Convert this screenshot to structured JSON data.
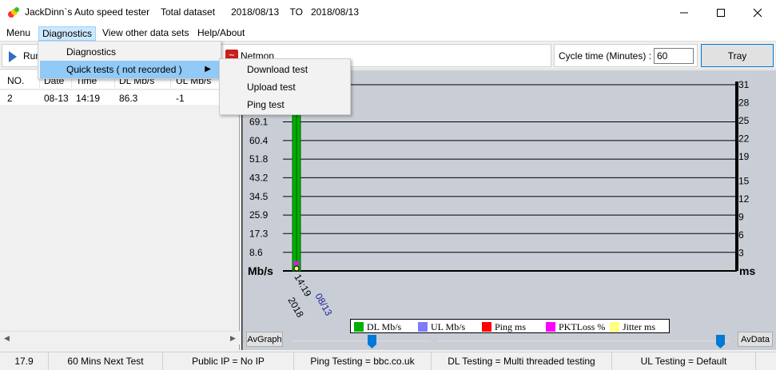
{
  "window": {
    "title": "JackDinn`s Auto speed tester",
    "dataset_label": "Total dataset",
    "date_from": "2018/08/13",
    "to_label": "TO",
    "date_to": "2018/08/13"
  },
  "menubar": {
    "items": [
      {
        "label": "Menu"
      },
      {
        "label": "Diagnostics"
      },
      {
        "label": "View other data sets"
      },
      {
        "label": "Help/About"
      }
    ]
  },
  "diagnostics_menu": {
    "items": [
      {
        "label": "Diagnostics"
      },
      {
        "label": "Quick tests ( not recorded )"
      }
    ]
  },
  "quick_tests_menu": {
    "items": [
      {
        "label": "Download test"
      },
      {
        "label": "Upload test"
      },
      {
        "label": "Ping test"
      }
    ]
  },
  "toolbar": {
    "run_label": "Run",
    "netmon_label": "Netmon",
    "cycle_label": "Cycle time (Minutes) :",
    "cycle_value": "60",
    "tray_label": "Tray"
  },
  "results_table": {
    "columns": [
      "NO.",
      "Date",
      "Time",
      "DL Mb/s",
      "UL Mb/s"
    ],
    "rows": [
      {
        "no": "2",
        "date": "08-13",
        "time": "14:19",
        "dl": "86.3",
        "ul": "-1"
      }
    ]
  },
  "chart_data": {
    "type": "bar",
    "left_axis_unit": "Mb/s",
    "right_axis_unit": "ms",
    "left_ticks": [
      "69.1",
      "60.4",
      "51.8",
      "43.2",
      "34.5",
      "25.9",
      "17.3",
      "8.6"
    ],
    "right_ticks": [
      "31",
      "28",
      "25",
      "22",
      "19",
      "15",
      "12",
      "9",
      "6",
      "3"
    ],
    "left_ylim": [
      0,
      86.3
    ],
    "right_ylim": [
      0,
      31
    ],
    "categories": [
      {
        "time": "14:19",
        "date": "08/13",
        "year": "2018"
      }
    ],
    "series": [
      {
        "name": "DL Mb/s",
        "color": "#00b000",
        "values": [
          86.3
        ]
      },
      {
        "name": "UL Mb/s",
        "color": "#7b7bff",
        "values": [
          -1
        ]
      },
      {
        "name": "Ping ms",
        "color": "#ff0000",
        "values": [
          null
        ]
      },
      {
        "name": "PKTLoss %",
        "color": "#ff00ff",
        "values": [
          null
        ]
      },
      {
        "name": "Jitter ms",
        "color": "#ffff80",
        "values": [
          null
        ]
      }
    ],
    "grid": true
  },
  "chart_controls": {
    "avgraph_label": "AvGraph",
    "avdata_label": "AvData"
  },
  "statusbar": {
    "cells": [
      {
        "text": "17.9"
      },
      {
        "text": "60 Mins Next Test"
      },
      {
        "text": "Public IP = No IP"
      },
      {
        "text": "Ping Testing = bbc.co.uk"
      },
      {
        "text": "DL Testing = Multi threaded testing"
      },
      {
        "text": "UL Testing = Default"
      }
    ]
  }
}
